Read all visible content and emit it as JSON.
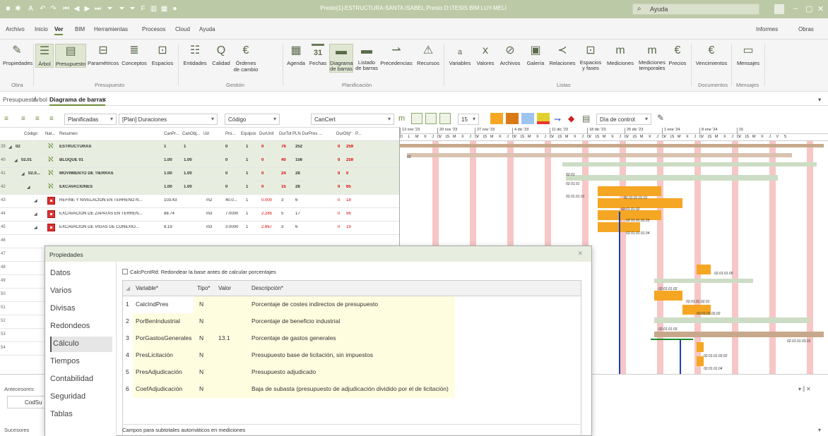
{
  "window": {
    "title": "Presto[1]-ESTRUCTURA-SANTA ISABEL.Presto D:\\TESIS BIM LUY-MELI",
    "search_placeholder": "Ayuda"
  },
  "menu": {
    "items": [
      "Archivo",
      "Inicio",
      "Ver",
      "BIM",
      "Herramientas",
      "Procesos",
      "Cloud",
      "Ayuda"
    ],
    "active": "Ver",
    "right": [
      "Informes",
      "Obras"
    ]
  },
  "ribbon": {
    "buttons": [
      "Propiedades",
      "Árbol",
      "Presupuesto",
      "Paramétricos",
      "Conceptos",
      "Espacios",
      "Entidades",
      "Calidad",
      "Órdenes de cambio",
      "Agenda",
      "Fechas",
      "Diagrama de barras",
      "Listado de barras",
      "Precedencias",
      "Recursos",
      "Variables",
      "Valores",
      "Archivos",
      "Galería",
      "Relaciones",
      "Espacios y fases",
      "Mediciones",
      "Mediciones temporales",
      "Precios",
      "Vencimientos",
      "Mensajes"
    ],
    "groups": [
      "Obra",
      "Presupuesto",
      "Gestión",
      "Planificación",
      "Listas",
      "Documentos",
      "Mensajes"
    ],
    "calendar_day": "31"
  },
  "tabs": [
    "Presupuesto",
    "Árbol",
    "Diagrama de barras"
  ],
  "toolbar": {
    "dd1": "Planificadas",
    "dd2": "[Plan] Duraciones",
    "dd3": "Código",
    "dd4": "CanCert",
    "dd5": "15",
    "dd6": "Día de control"
  },
  "columns": [
    "Código",
    "Nat...",
    "Resumen",
    "CanPr...",
    "CanObj...",
    "Ud",
    "Pro...",
    "Equipos",
    "DurUnit",
    "DurTot",
    "PLN DurPres ...",
    "DurObj*",
    "P..."
  ],
  "rows": [
    {
      "n": "39",
      "code": "02",
      "res": "ESTRUCTURAS",
      "canpr": "1",
      "canobj": "1",
      "ud": "",
      "pro": "0",
      "eq": "1",
      "du": "0",
      "dt": "76",
      "pln": "252",
      "dobj": "0",
      "p": "259",
      "type": "t"
    },
    {
      "n": "40",
      "code": "02.01",
      "res": "BLOQUE 01",
      "canpr": "1.00",
      "canobj": "1.00",
      "ud": "",
      "pro": "0",
      "eq": "1",
      "du": "0",
      "dt": "40",
      "pln": "156",
      "dobj": "0",
      "p": "259",
      "type": "t"
    },
    {
      "n": "41",
      "code": "02.0...",
      "res": "MOVIMIENTO DE TIERRAS",
      "canpr": "1.00",
      "canobj": "1.00",
      "ud": "",
      "pro": "0",
      "eq": "1",
      "du": "0",
      "dt": "24",
      "pln": "28",
      "dobj": "0",
      "p": "0",
      "type": "t"
    },
    {
      "n": "42",
      "code": "",
      "res": "EXCAVACIONES",
      "canpr": "1.00",
      "canobj": "1.00",
      "ud": "",
      "pro": "0",
      "eq": "1",
      "du": "0",
      "dt": "15",
      "pln": "28",
      "dobj": "0",
      "p": "65",
      "type": "t"
    },
    {
      "n": "43",
      "code": "",
      "res": "REFINE Y NIVELACIÓN EN TERRENO N...",
      "canpr": "103.43",
      "canobj": "",
      "ud": "m2",
      "pro": "40.0...",
      "eq": "1",
      "du": "0.000",
      "dt": "3",
      "pln": "6",
      "dobj": "0",
      "p": "18",
      "type": "r"
    },
    {
      "n": "44",
      "code": "",
      "res": "EXCAVACION DE ZAPATAS EN TERREN...",
      "canpr": "88.74",
      "canobj": "",
      "ud": "m3",
      "pro": "7.0000",
      "eq": "1",
      "du": "2.285",
      "dt": "5",
      "pln": "17",
      "dobj": "0",
      "p": "56",
      "type": "r"
    },
    {
      "n": "45",
      "code": "",
      "res": "EXCAVACION DE VIGAS DE CONEXIO...",
      "canpr": "8.19",
      "canobj": "",
      "ud": "m3",
      "pro": "3.0000",
      "eq": "1",
      "du": "2.667",
      "dt": "3",
      "pln": "6",
      "dobj": "0",
      "p": "19",
      "type": "r"
    }
  ],
  "row_numbers_hidden": [
    "46",
    "47",
    "48",
    "49",
    "50",
    "51",
    "52",
    "53",
    "54"
  ],
  "gantt": {
    "weeks": [
      "13 nov '23",
      "20 nov '23",
      "27 nov '23",
      "4 dic '23",
      "11 dic '23",
      "18 dic '23",
      "25 dic '23",
      "1 ene '24",
      "8 ene '24",
      "15"
    ],
    "days": "D L M X J V S",
    "labels": [
      "02",
      "02.01",
      "02.01.01",
      "02.01.01.01",
      "02.01.01.01.01",
      "02.01.01.02",
      "02.01.01.01.03",
      "02.01.01.01.04",
      "02.01.01.05",
      "02.01.01.02",
      "02.01.01.02.01",
      "02.01.01.02.02",
      "02.01.01.03",
      "02.01.01.03.01",
      "02.01.01.03.02",
      "02.01.01.04"
    ]
  },
  "bottom": {
    "antecesores": "Antecesores",
    "codsu": "CodSu",
    "sucesores": "Sucesores"
  },
  "dialog": {
    "title": "Propiedades",
    "nav": [
      "Datos",
      "Varios",
      "Divisas",
      "Redondeos",
      "Cálculo",
      "Tiempos",
      "Contabilidad",
      "Seguridad",
      "Tablas"
    ],
    "selected": "Cálculo",
    "checkbox": "CalcPcntRd: Redondear la base antes de calcular porcentajes",
    "headers": [
      "Variable*",
      "Tipo*",
      "Valor",
      "Descripción*"
    ],
    "rows": [
      {
        "n": "1",
        "var": "CalcIndPres",
        "tipo": "N",
        "valor": "",
        "desc": "Porcentaje de costes indirectos de presupuesto"
      },
      {
        "n": "2",
        "var": "PorBenIndustrial",
        "tipo": "N",
        "valor": "",
        "desc": "Porcentaje de beneficio industrial"
      },
      {
        "n": "3",
        "var": "PorGastosGenerales",
        "tipo": "N",
        "valor": "13.1",
        "desc": "Porcentaje de gastos generales"
      },
      {
        "n": "4",
        "var": "PresLicitación",
        "tipo": "N",
        "valor": "",
        "desc": "Presupuesto base de licitación, sin impuestos"
      },
      {
        "n": "5",
        "var": "PresAdjudicación",
        "tipo": "N",
        "valor": "",
        "desc": "Presupuesto adjudicado"
      },
      {
        "n": "6",
        "var": "CoefAdjudicación",
        "tipo": "N",
        "valor": "",
        "desc": "Baja de subasta (presupuesto de adjudicación dividido por el de licitación)"
      }
    ],
    "group": "Campos para subtotales automáticos en mediciones"
  }
}
